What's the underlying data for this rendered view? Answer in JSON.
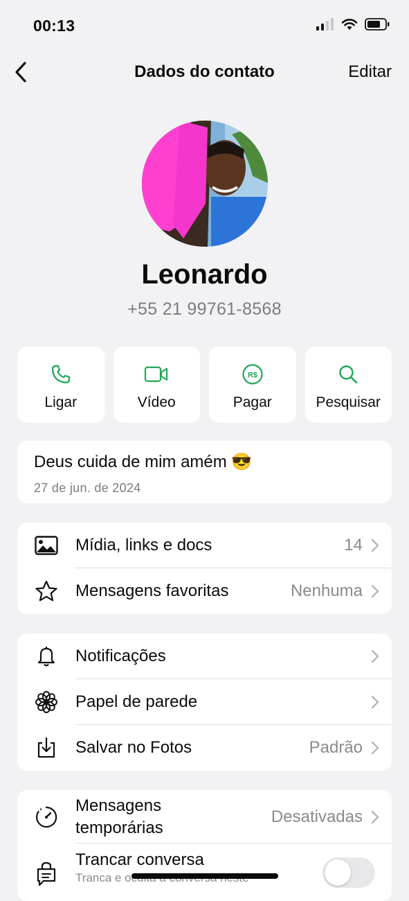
{
  "status": {
    "time": "00:13"
  },
  "nav": {
    "title": "Dados do contato",
    "edit": "Editar"
  },
  "contact": {
    "name": "Leonardo",
    "phone": "+55 21 99761-8568"
  },
  "actions": [
    {
      "label": "Ligar",
      "icon": "phone-icon"
    },
    {
      "label": "Vídeo",
      "icon": "video-icon"
    },
    {
      "label": "Pagar",
      "icon": "pay-icon"
    },
    {
      "label": "Pesquisar",
      "icon": "search-icon"
    }
  ],
  "pay_symbol": "R$",
  "about": {
    "text": "Deus cuida de mim amém 😎",
    "date": "27 de jun. de 2024"
  },
  "group1": [
    {
      "label": "Mídia, links e docs",
      "value": "14",
      "icon": "image-icon"
    },
    {
      "label": "Mensagens favoritas",
      "value": "Nenhuma",
      "icon": "star-icon"
    }
  ],
  "group2": [
    {
      "label": "Notificações",
      "value": "",
      "icon": "bell-icon"
    },
    {
      "label": "Papel de parede",
      "value": "",
      "icon": "flower-icon"
    },
    {
      "label": "Salvar no Fotos",
      "value": "Padrão",
      "icon": "save-icon"
    }
  ],
  "group3": [
    {
      "label_line1": "Mensagens",
      "label_line2": "temporárias",
      "value": "Desativadas",
      "icon": "timer-icon"
    },
    {
      "label": "Trancar conversa",
      "sublabel": "Tranca e oculta a conversa neste",
      "icon": "lock-chat-icon",
      "toggle_on": false
    }
  ],
  "colors": {
    "accent": "#1fa855",
    "background": "#f2f2f4",
    "card": "#ffffff"
  }
}
